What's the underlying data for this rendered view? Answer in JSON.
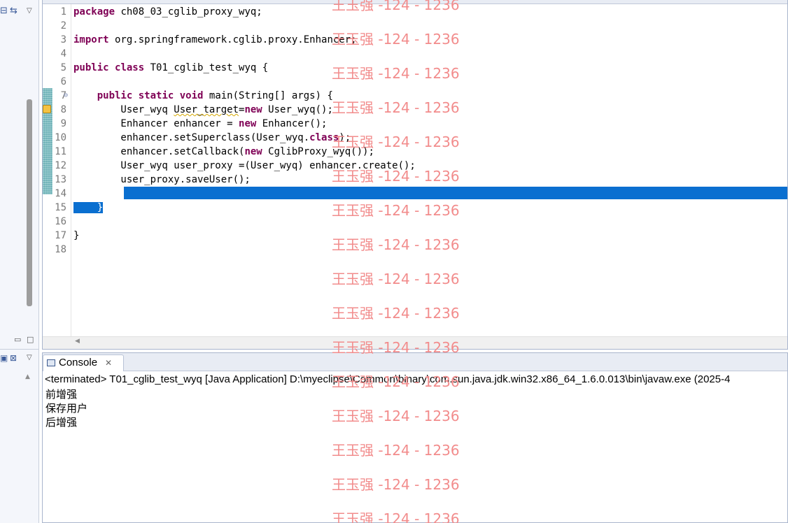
{
  "editor": {
    "lines": [
      {
        "n": "1",
        "parts": [
          {
            "t": "package",
            "k": true
          },
          {
            "t": " ch08_03_cglib_proxy_wyq;"
          }
        ]
      },
      {
        "n": "2",
        "parts": []
      },
      {
        "n": "3",
        "parts": [
          {
            "t": "import",
            "k": true
          },
          {
            "t": " org.springframework.cglib.proxy.Enhancer;"
          }
        ]
      },
      {
        "n": "4",
        "parts": []
      },
      {
        "n": "5",
        "parts": [
          {
            "t": "public",
            "k": true
          },
          {
            "t": " "
          },
          {
            "t": "class",
            "k": true
          },
          {
            "t": " T01_cglib_test_wyq {"
          }
        ]
      },
      {
        "n": "6",
        "parts": []
      },
      {
        "n": "7",
        "parts": [
          {
            "t": "    "
          },
          {
            "t": "public",
            "k": true
          },
          {
            "t": " "
          },
          {
            "t": "static",
            "k": true
          },
          {
            "t": " "
          },
          {
            "t": "void",
            "k": true
          },
          {
            "t": " main(String[] args) {"
          }
        ]
      },
      {
        "n": "8",
        "parts": [
          {
            "t": "        User_wyq "
          },
          {
            "t": "User_target",
            "w": true
          },
          {
            "t": "="
          },
          {
            "t": "new",
            "k": true
          },
          {
            "t": " User_wyq();"
          }
        ]
      },
      {
        "n": "9",
        "parts": [
          {
            "t": "        Enhancer enhancer = "
          },
          {
            "t": "new",
            "k": true
          },
          {
            "t": " Enhancer();"
          }
        ]
      },
      {
        "n": "10",
        "parts": [
          {
            "t": "        enhancer.setSuperclass(User_wyq."
          },
          {
            "t": "class",
            "k": true
          },
          {
            "t": ");"
          }
        ]
      },
      {
        "n": "11",
        "parts": [
          {
            "t": "        enhancer.setCallback("
          },
          {
            "t": "new",
            "k": true
          },
          {
            "t": " CglibProxy_wyq());"
          }
        ]
      },
      {
        "n": "12",
        "parts": [
          {
            "t": "        User_wyq user_proxy =(User_wyq) enhancer.create();"
          }
        ]
      },
      {
        "n": "13",
        "parts": [
          {
            "t": "        user_proxy.saveUser();"
          }
        ]
      },
      {
        "n": "14",
        "parts": []
      },
      {
        "n": "15",
        "parts": [
          {
            "t": "    }",
            "s": true
          }
        ]
      },
      {
        "n": "16",
        "parts": []
      },
      {
        "n": "17",
        "parts": [
          {
            "t": "}"
          }
        ]
      },
      {
        "n": "18",
        "parts": []
      }
    ]
  },
  "console": {
    "tab_label": "Console",
    "close_glyph": "✕",
    "status": "<terminated> T01_cglib_test_wyq [Java Application] D:\\myeclipse\\Common\\binary\\com.sun.java.jdk.win32.x86_64_1.6.0.013\\bin\\javaw.exe (2025-4",
    "output": [
      "前增强",
      "保存用户",
      "后增强"
    ]
  },
  "watermark": "王玉强 -124 - 1236",
  "colors": {
    "keyword": "#7f0055",
    "selection": "#0a6fd0",
    "watermark": "#f28c8c",
    "line_number": "#787878"
  }
}
